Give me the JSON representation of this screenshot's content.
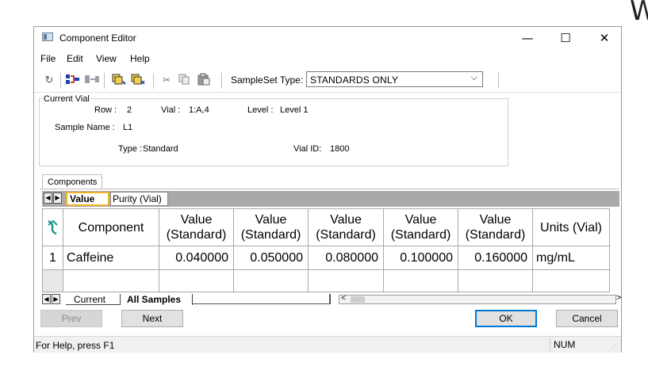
{
  "corner_glyph": "W",
  "window": {
    "title": "Component Editor",
    "controls": {
      "minimize": "—",
      "maximize": "☐",
      "close": "✕"
    }
  },
  "menu": [
    "File",
    "Edit",
    "View",
    "Help"
  ],
  "toolbar": {
    "sampleset_label": "SampleSet Type:",
    "sampleset_value": "STANDARDS ONLY",
    "icons": [
      "refresh-icon",
      "component-link-icon",
      "component-sync-icon",
      "copy-sample-icon",
      "paste-sample-icon",
      "cut-icon",
      "copy-icon",
      "paste-icon"
    ]
  },
  "current_vial": {
    "group_title": "Current Vial",
    "row_label": "Row :",
    "row_value": "2",
    "vial_label": "Vial :",
    "vial_value": "1:A,4",
    "level_label": "Level :",
    "level_value": "Level 1",
    "sample_name_label": "Sample Name :",
    "sample_name_value": "L1",
    "type_label": "Type :",
    "type_value": "Standard",
    "vial_id_label": "Vial ID:",
    "vial_id_value": "1800"
  },
  "components_tab": "Components",
  "inner_tabs": [
    "Value",
    "Purity (Vial)"
  ],
  "grid": {
    "corner_icon": "sort-icon",
    "headers": [
      "Component",
      "Value\n(Standard)",
      "Value\n(Standard)",
      "Value\n(Standard)",
      "Value\n(Standard)",
      "Value\n(Standard)",
      "Units (Vial)"
    ],
    "rows": [
      {
        "num": "1",
        "cells": [
          "Caffeine",
          "0.040000",
          "0.050000",
          "0.080000",
          "0.100000",
          "0.160000",
          "mg/mL"
        ]
      }
    ]
  },
  "sheet_tabs": [
    "Current",
    "All Samples"
  ],
  "buttons": {
    "prev": "Prev",
    "next": "Next",
    "ok": "OK",
    "cancel": "Cancel"
  },
  "status": {
    "help": "For Help, press F1",
    "num": "NUM"
  }
}
